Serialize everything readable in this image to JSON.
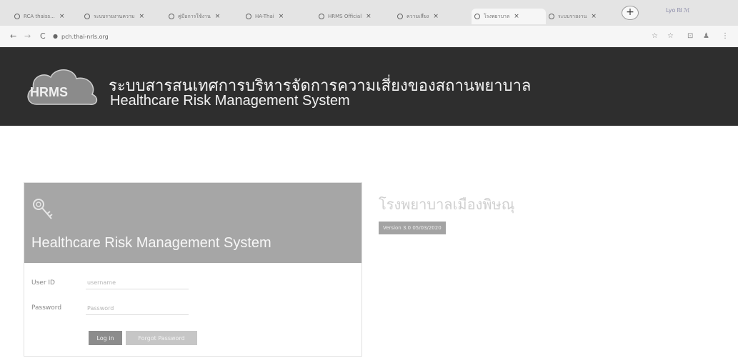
{
  "browser": {
    "tabs": [
      {
        "title": "RCA thaiss...",
        "active": false
      },
      {
        "title": "ระบบรายงานความ",
        "active": false
      },
      {
        "title": "คู่มือการใช้งาน",
        "active": false
      },
      {
        "title": "HA-Thai",
        "active": false
      },
      {
        "title": "HRMS Official",
        "active": false
      },
      {
        "title": "ความเสี่ยง",
        "active": false
      },
      {
        "title": "โรงพยาบาล",
        "active": true
      },
      {
        "title": "ระบบรายงาน",
        "active": false
      }
    ],
    "new_tab": "+",
    "right_label": "Lyo ₪ ℳ",
    "url": "pch.thai-nrls.org",
    "back": "←",
    "forward": "→",
    "reload": "C",
    "toolbar_icons": [
      "☆",
      "☆",
      "⊡",
      "♟",
      "⋮"
    ]
  },
  "header": {
    "logo_text": "HRMS",
    "title_thai": "ระบบสารสนเทศการบริหารจัดการความเสี่ยงของสถานพยาบาล",
    "title_en": "Healthcare Risk Management System"
  },
  "login": {
    "card_title": "Healthcare Risk Management System",
    "user_label": "User ID",
    "user_placeholder": "username",
    "password_label": "Password",
    "password_placeholder": "Password",
    "login_button": "Log in",
    "forgot_button": "Forgot Password"
  },
  "hospital": {
    "name": "โรงพยาบาลเมืองพิษณุ",
    "version": "Version 3.0 05/03/2020"
  },
  "colors": {
    "header_bg": "#2e2e2e",
    "banner_bg": "#a6a6a6",
    "button_primary": "#8c8c8c",
    "button_secondary": "#c6c6c6"
  }
}
